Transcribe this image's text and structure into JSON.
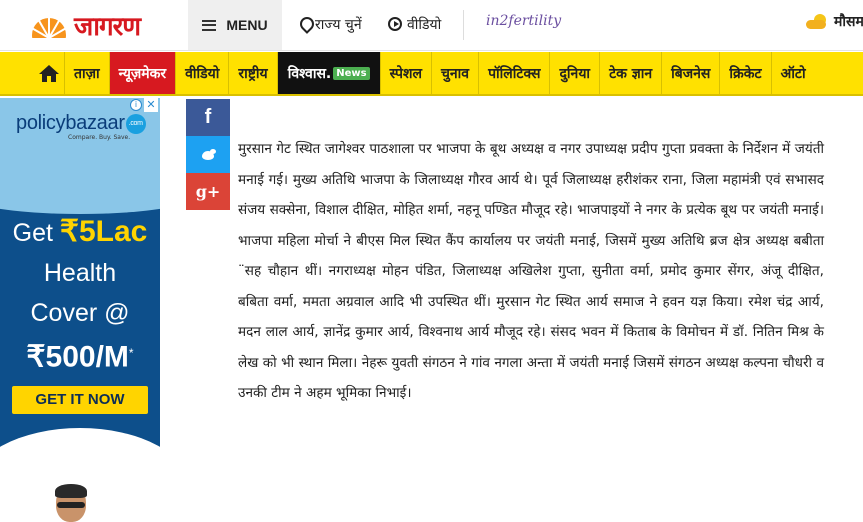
{
  "header": {
    "logo_text": "जागरण",
    "menu_label": "MENU",
    "state_link": "राज्य चुनें",
    "video_link": "वीडियो",
    "partner_logo": "in2fertility",
    "weather_text": "मौसम"
  },
  "nav": {
    "items": [
      {
        "label": "ताज़ा",
        "style": "normal"
      },
      {
        "label": "न्यूज़मेकर",
        "style": "active"
      },
      {
        "label": "वीडियो",
        "style": "normal"
      },
      {
        "label": "राष्ट्रीय",
        "style": "normal"
      },
      {
        "label": "विश्वास.",
        "badge": "News",
        "style": "dark"
      },
      {
        "label": "स्पेशल",
        "style": "normal"
      },
      {
        "label": "चुनाव",
        "style": "normal"
      },
      {
        "label": "पॉलिटिक्स",
        "style": "normal"
      },
      {
        "label": "दुनिया",
        "style": "normal"
      },
      {
        "label": "टेक ज्ञान",
        "style": "normal"
      },
      {
        "label": "बिजनेस",
        "style": "normal"
      },
      {
        "label": "क्रिकेट",
        "style": "normal"
      },
      {
        "label": "ऑटो",
        "style": "normal"
      }
    ],
    "accent_color": "#ffe100",
    "active_color": "#d71920"
  },
  "ad": {
    "brand": "policybazaar",
    "brand_badge": ".com",
    "tagline": "Compare. Buy. Save.",
    "line1_prefix": "Get ",
    "line1_amount": "₹5Lac",
    "line2": "Health",
    "line3": "Cover @",
    "line4": "₹500/M",
    "line4_mark": "*",
    "cta": "GET IT NOW",
    "close_glyph": "✕",
    "choice_glyph": "i"
  },
  "share": {
    "facebook": "f",
    "googleplus": "g+"
  },
  "article": {
    "body": "मुरसान गेट स्थित जागेश्वर पाठशाला पर भाजपा के बूथ अध्यक्ष व नगर उपाध्यक्ष प्रदीप गुप्ता प्रवक्ता के निर्देशन में जयंती मनाई गई। मुख्य अतिथि भाजपा के जिलाध्यक्ष गौरव आर्य थे। पूर्व जिलाध्यक्ष हरीशंकर राना, जिला महामंत्री एवं सभासद संजय सक्सेना, विशाल दीक्षित, मोहित शर्मा, नहनू पण्डित मौजूद रहे। भाजपाइयों ने नगर के प्रत्येक बूथ पर जयंती मनाई। भाजपा महिला मोर्चा ने बीएस मिल स्थित कैंप कार्यालय पर जयंती मनाई, जिसमें मुख्य अतिथि ब्रज क्षेत्र अध्यक्ष बबीता ¨सह चौहान थीं। नगराध्यक्ष मोहन पंडित, जिलाध्यक्ष अखिलेश गुप्ता, सुनीता वर्मा, प्रमोद कुमार सेंगर, अंजू दीक्षित, बबिता वर्मा, ममता अग्रवाल आदि भी उपस्थित थीं। मुरसान गेट स्थित आर्य समाज ने हवन यज्ञ किया। रमेश चंद्र आर्य, मदन लाल आर्य, ज्ञानेंद्र कुमार आर्य, विश्वनाथ आर्य मौजूद रहे। संसद भवन में किताब के विमोचन में डॉ. नितिन मिश्र के लेख को भी स्थान मिला। नेहरू युवती संगठन ने गांव नगला अन्ता में जयंती मनाई जिसमें संगठन अध्यक्ष कल्पना चौधरी व उनकी टीम ने अहम भूमिका निभाई।"
  }
}
